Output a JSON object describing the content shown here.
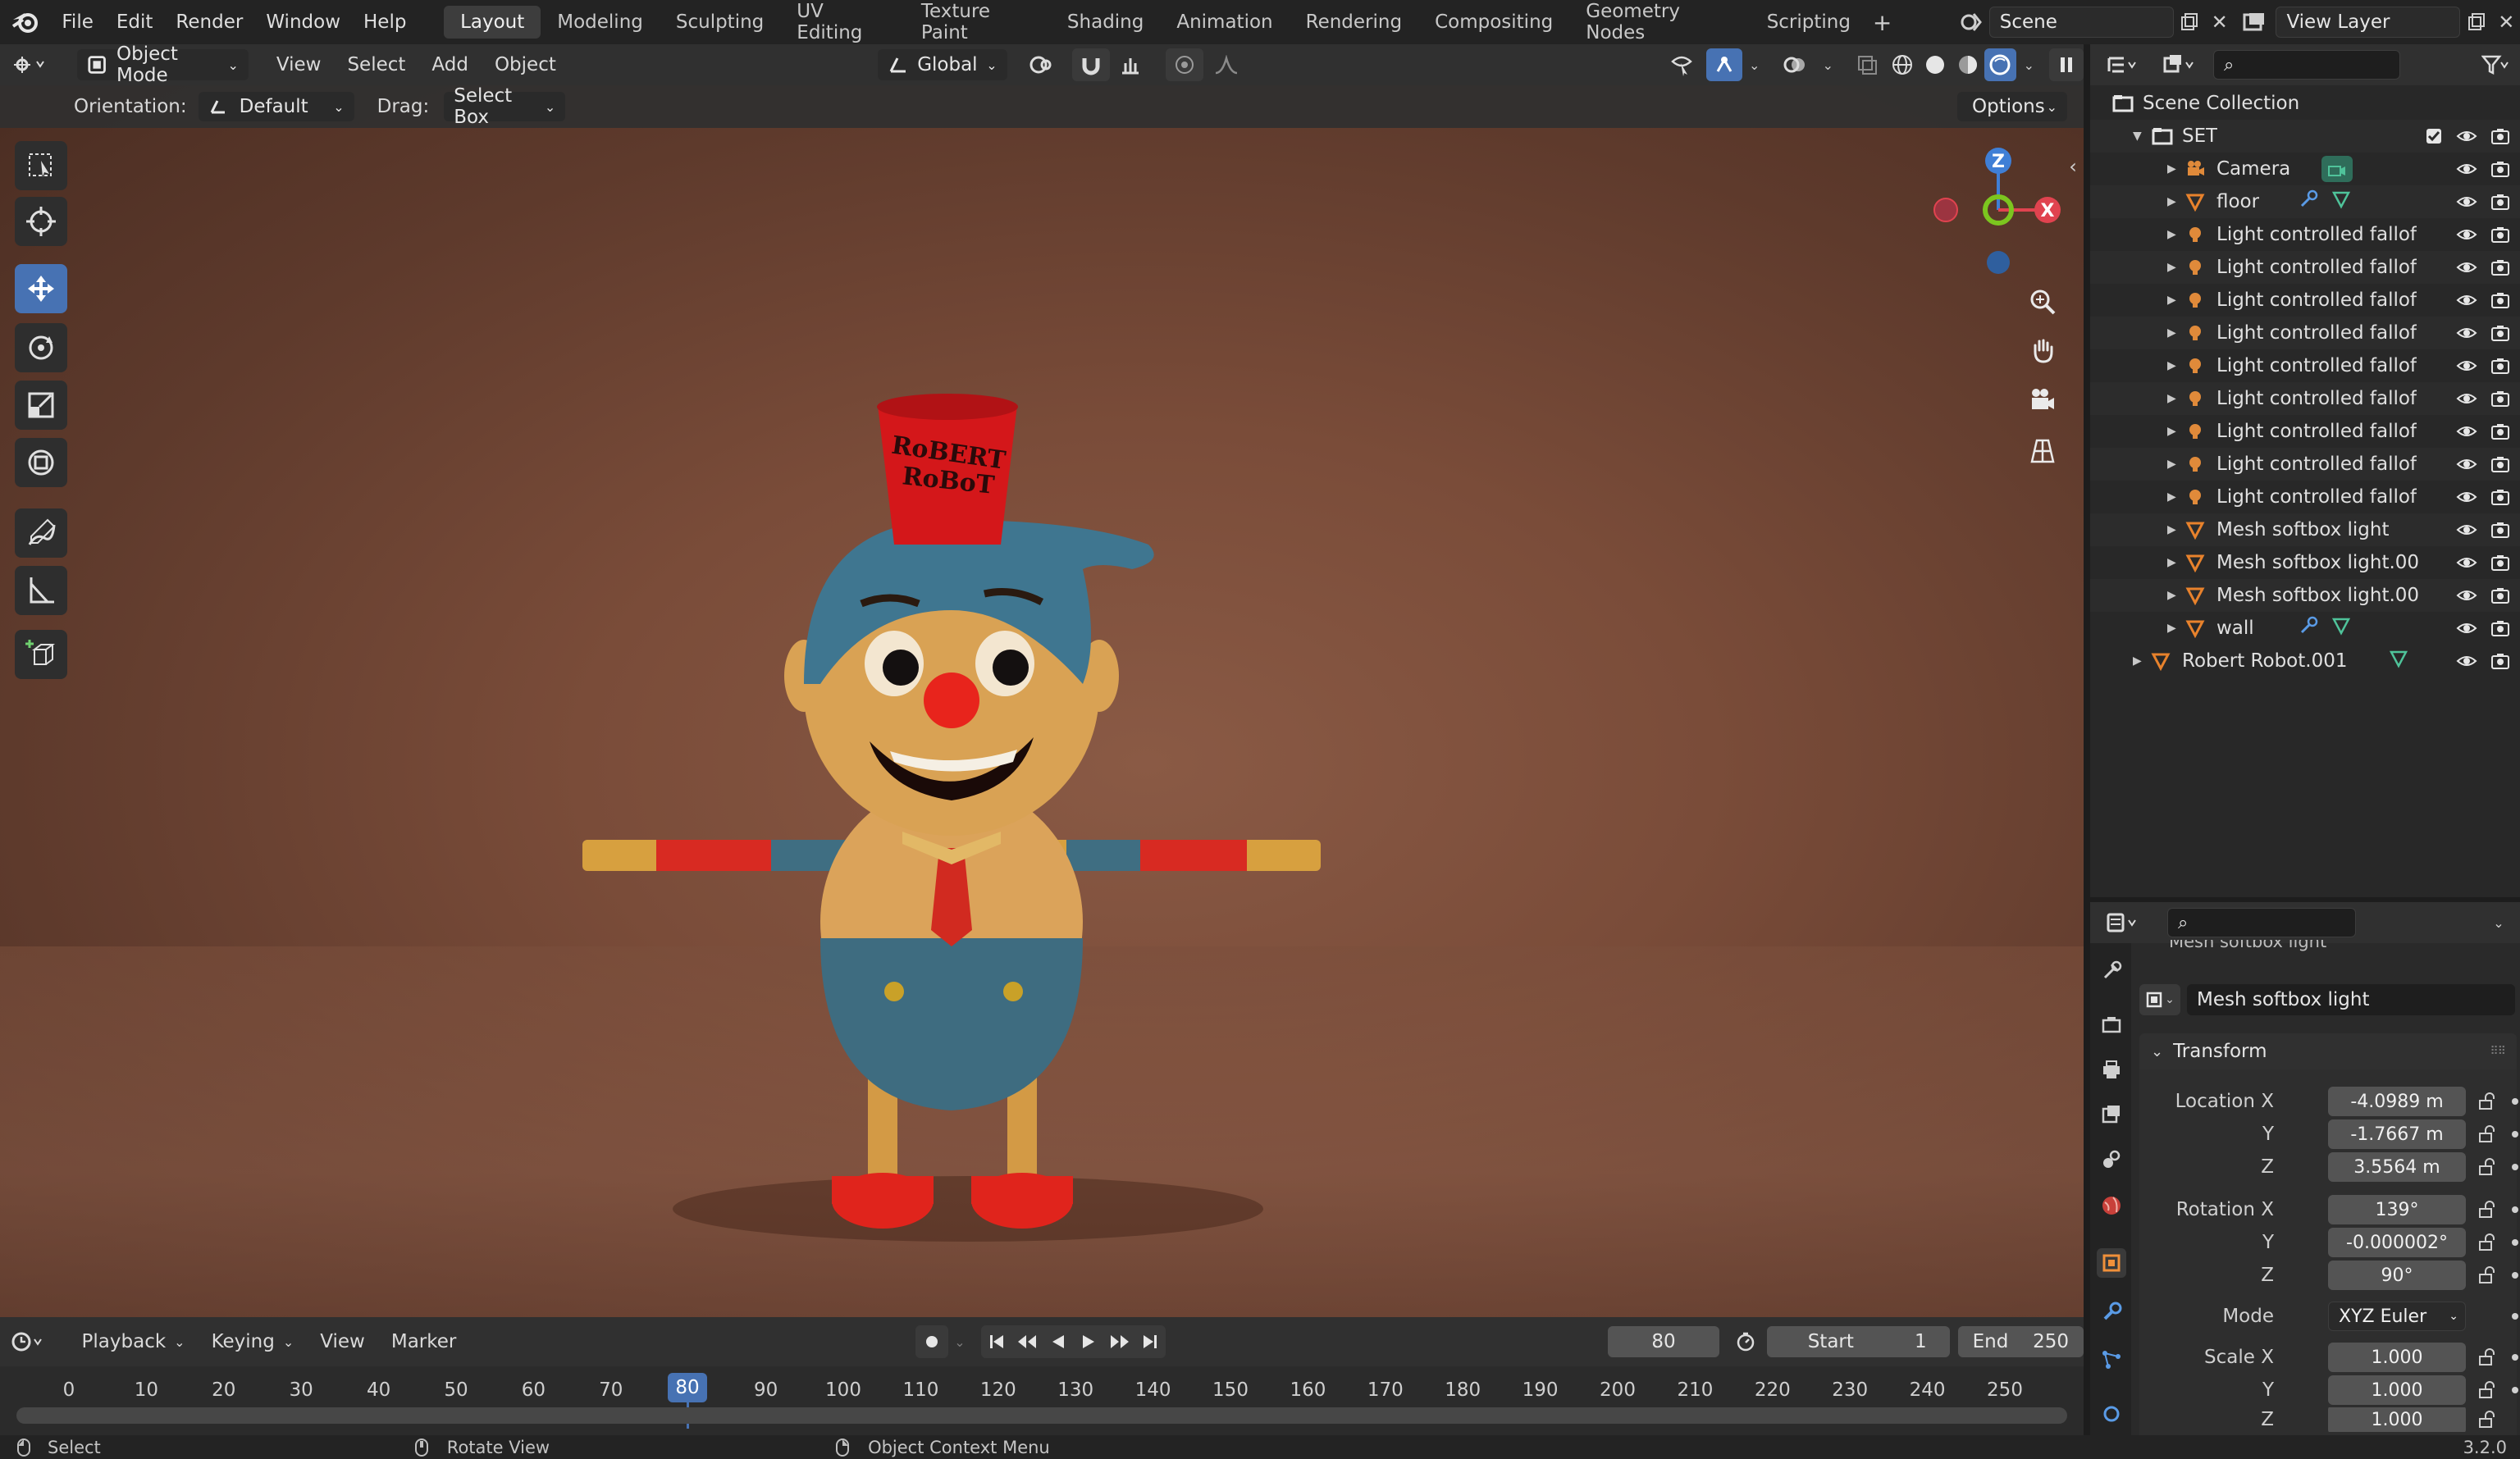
{
  "menu": [
    "File",
    "Edit",
    "Render",
    "Window",
    "Help"
  ],
  "workspaces": [
    "Layout",
    "Modeling",
    "Sculpting",
    "UV Editing",
    "Texture Paint",
    "Shading",
    "Animation",
    "Rendering",
    "Compositing",
    "Geometry Nodes",
    "Scripting"
  ],
  "active_workspace": "Layout",
  "scene": "Scene",
  "view_layer": "View Layer",
  "header": {
    "mode": "Object Mode",
    "menus": [
      "View",
      "Select",
      "Add",
      "Object"
    ],
    "transform_orientation": "Global"
  },
  "tool_settings": {
    "orientation_label": "Orientation:",
    "orientation_value": "Default",
    "drag_label": "Drag:",
    "drag_value": "Select Box",
    "options": "Options"
  },
  "viewport": {
    "hat_text_line1": "RoBERT",
    "hat_text_line2": "RoBoT",
    "gizmo_axes": [
      "Z",
      "X"
    ]
  },
  "outliner": {
    "root": "Scene Collection",
    "collection": "SET",
    "items": [
      {
        "name": "Camera",
        "type": "camera"
      },
      {
        "name": "floor",
        "type": "mesh"
      },
      {
        "name": "Light controlled fallof",
        "type": "light"
      },
      {
        "name": "Light controlled fallof",
        "type": "light"
      },
      {
        "name": "Light controlled fallof",
        "type": "light"
      },
      {
        "name": "Light controlled fallof",
        "type": "light"
      },
      {
        "name": "Light controlled fallof",
        "type": "light"
      },
      {
        "name": "Light controlled fallof",
        "type": "light"
      },
      {
        "name": "Light controlled fallof",
        "type": "light"
      },
      {
        "name": "Light controlled fallof",
        "type": "light"
      },
      {
        "name": "Light controlled fallof",
        "type": "light"
      },
      {
        "name": "Mesh softbox light",
        "type": "mesh"
      },
      {
        "name": "Mesh softbox light.00",
        "type": "mesh"
      },
      {
        "name": "Mesh softbox light.00",
        "type": "mesh"
      },
      {
        "name": "wall",
        "type": "mesh"
      }
    ],
    "top_item": "Robert Robot.001"
  },
  "properties": {
    "clipped_title": "Mesh softbox light",
    "object_name": "Mesh softbox light",
    "panel": "Transform",
    "location_label": "Location X",
    "location": [
      "-4.0989 m",
      "-1.7667 m",
      "3.5564 m"
    ],
    "rotation_label": "Rotation X",
    "rotation": [
      "139°",
      "-0.000002°",
      "90°"
    ],
    "mode_label": "Mode",
    "mode_value": "XYZ Euler",
    "scale_label": "Scale X",
    "scale": [
      "1.000",
      "1.000",
      "1.000"
    ],
    "y_label": "Y",
    "z_label": "Z"
  },
  "timeline": {
    "menus": [
      "Playback",
      "Keying",
      "View",
      "Marker"
    ],
    "current_frame": "80",
    "start_label": "Start",
    "start": "1",
    "end_label": "End",
    "end": "250",
    "ticks": [
      "0",
      "10",
      "20",
      "30",
      "40",
      "50",
      "60",
      "70",
      "80",
      "90",
      "100",
      "110",
      "120",
      "130",
      "140",
      "150",
      "160",
      "170",
      "180",
      "190",
      "200",
      "210",
      "220",
      "230",
      "240",
      "250"
    ]
  },
  "statusbar": {
    "select": "Select",
    "rotate": "Rotate View",
    "context": "Object Context Menu",
    "version": "3.2.0"
  },
  "colors": {
    "accent": "#4772b3",
    "light_icon": "#e08a3a",
    "mesh_icon": "#e8822c",
    "data_icon": "#4fc39a"
  }
}
